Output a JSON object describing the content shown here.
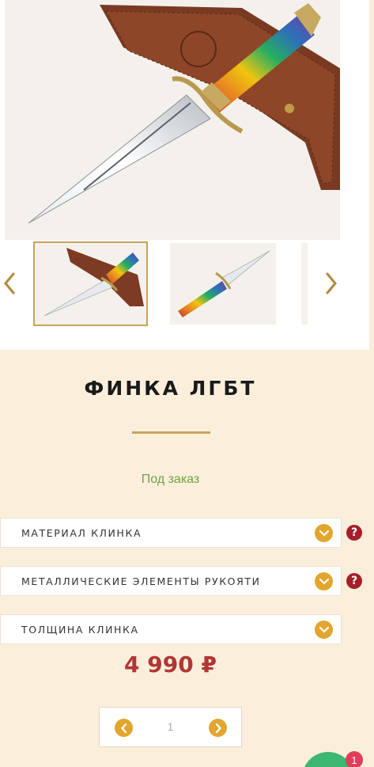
{
  "product": {
    "title": "ФИНКА ЛГБТ",
    "availability": "Под заказ",
    "price": "4 990 ₽"
  },
  "gallery": {
    "thumbnail_count_visible": 3,
    "active_index": 0
  },
  "options": [
    {
      "label": "МАТЕРИАЛ КЛИНКА",
      "has_help": true
    },
    {
      "label": "МЕТАЛЛИЧЕСКИЕ ЭЛЕМЕНТЫ РУКОЯТИ",
      "has_help": true
    },
    {
      "label": "ТОЛЩИНА КЛИНКА",
      "has_help": false
    }
  ],
  "help_glyph": "?",
  "quantity": {
    "value": "1"
  },
  "chat": {
    "badge_count": "1"
  },
  "colors": {
    "accent_gold": "#c9a35a",
    "button_orange": "#e2a62e",
    "price_red": "#b13636",
    "availability_green": "#6fa53f",
    "help_red": "#a61e2a",
    "page_bg": "#fbeedb"
  }
}
